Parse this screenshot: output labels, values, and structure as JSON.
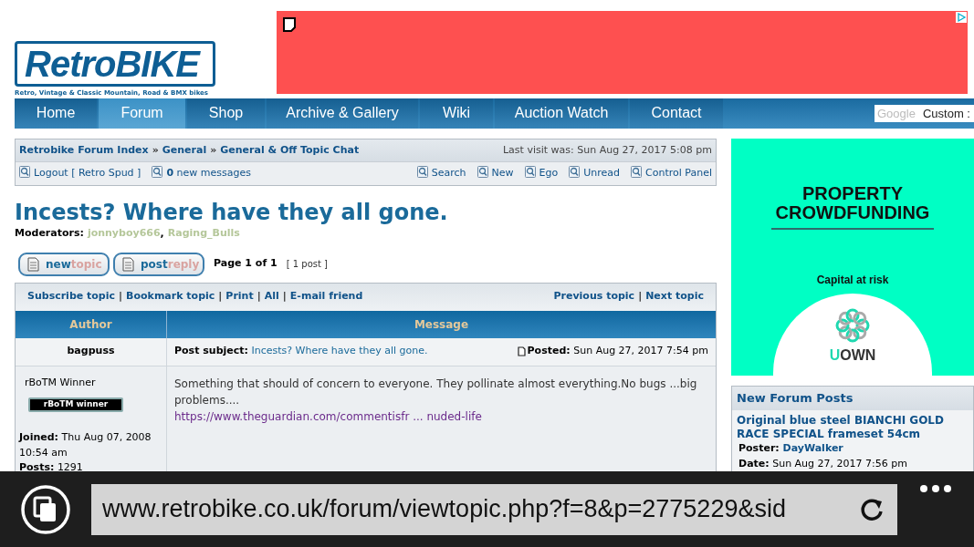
{
  "logo": {
    "title": "RetroBIKE",
    "tagline": "Retro, Vintage & Classic Mountain, Road & BMX bikes"
  },
  "nav": {
    "tabs": [
      {
        "label": "Home",
        "selected": false
      },
      {
        "label": "Forum",
        "selected": true
      },
      {
        "label": "Shop",
        "selected": false
      },
      {
        "label": "Archive & Gallery",
        "selected": false
      },
      {
        "label": "Wiki",
        "selected": false
      },
      {
        "label": "Auction Watch",
        "selected": false
      },
      {
        "label": "Contact",
        "selected": false
      }
    ],
    "search": {
      "brand": "Google",
      "placeholder": "Custom :"
    }
  },
  "breadcrumb": {
    "items": [
      "Retrobike Forum Index",
      "General",
      "General & Off Topic Chat"
    ],
    "separator": "»",
    "last_visit": "Last visit was: Sun Aug 27, 2017 5:08 pm"
  },
  "user_links": {
    "logout": "Logout [ Retro Spud ]",
    "messages_count": "0",
    "messages_label": "new messages",
    "actions": [
      "Search",
      "New",
      "Ego",
      "Unread",
      "Control Panel"
    ]
  },
  "topic": {
    "title": "Incests? Where have they all gone.",
    "moderators_label": "Moderators:",
    "moderators": [
      "jonnyboy666",
      "Raging_Bulls"
    ],
    "moderator_separator": ",",
    "link_separator": "|",
    "buttons": [
      {
        "first": "new",
        "second": "topic"
      },
      {
        "first": "post",
        "second": "reply"
      }
    ],
    "page": "Page 1 of 1",
    "post_count": "[ 1 post ]",
    "tools": [
      "Subscribe topic",
      "Bookmark topic",
      "Print",
      "All",
      "E-mail friend"
    ],
    "nav_links": [
      "Previous topic",
      "Next topic"
    ],
    "columns": [
      "Author",
      "Message"
    ]
  },
  "post": {
    "author": "bagpuss",
    "subject_label": "Post subject:",
    "subject": "Incests? Where have they all gone.",
    "posted_label": "Posted:",
    "posted": "Sun Aug 27, 2017 7:54 pm",
    "rank": "rBoTM Winner",
    "rank_badge": "rBoTM winner",
    "joined_label": "Joined:",
    "joined": "Thu Aug 07, 2008 10:54 am",
    "posts_label": "Posts:",
    "posts": "1291",
    "body": "Something that should of concern to everyone. They pollinate almost everything.No bugs ...big problems....",
    "link": "https://www.theguardian.com/commentisfr ... nuded-life"
  },
  "side_ad": {
    "headline_1": "PROPERTY",
    "headline_2": "CROWDFUNDING",
    "note": "Capital at risk",
    "brand_first": "U",
    "brand_rest": "OWN"
  },
  "new_posts": {
    "title": "New Forum Posts",
    "items": [
      {
        "title": "Original blue steel BIANCHI GOLD RACE SPECIAL frameset 54cm",
        "poster_label": "Poster:",
        "poster": "DayWalker",
        "date_label": "Date:",
        "date": "Sun Aug 27, 2017 7:56 pm"
      }
    ]
  },
  "browser": {
    "url": "www.retrobike.co.uk/forum/viewtopic.php?f=8&p=2775229&sid"
  }
}
